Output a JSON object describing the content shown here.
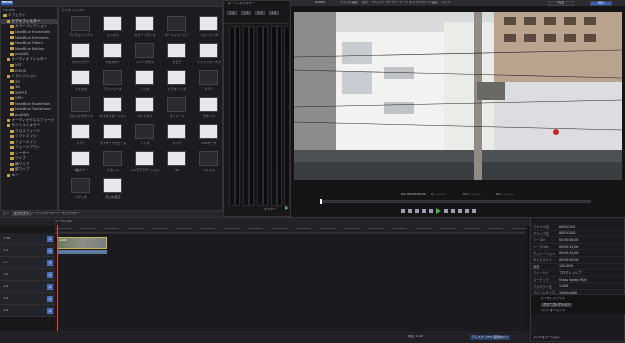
{
  "app": {
    "brand": "EDIUS",
    "brand2": "EDIUS"
  },
  "menus_left": [
    "ファイル",
    "編集",
    "表示",
    "クリップ",
    "マーカー",
    "モード",
    "キャプチャ",
    "ツール",
    "設定",
    "ヘルプ"
  ],
  "menus_right": [
    "ファイル",
    "編集",
    "表示",
    "クリップ",
    "マーカー",
    "モード",
    "キャプチャ",
    "ツール",
    "設定",
    "ヘルプ"
  ],
  "bin": {
    "title": "エフェクト",
    "subtitle": "FOLDER",
    "tree": [
      {
        "label": "エフェクト",
        "level": 0
      },
      {
        "label": "ビデオフィルター",
        "level": 1,
        "selected": true
      },
      {
        "label": "カラーコレクション",
        "level": 2
      },
      {
        "label": "NewBlue Essentials",
        "level": 2
      },
      {
        "label": "NewBlue Elements",
        "level": 2
      },
      {
        "label": "NewBlue Filters",
        "level": 2
      },
      {
        "label": "NewBlue Motion",
        "level": 2
      },
      {
        "label": "proDAD",
        "level": 2
      },
      {
        "label": "オーディオフィルター",
        "level": 1
      },
      {
        "label": "VST",
        "level": 2
      },
      {
        "label": "EDIUS",
        "level": 2
      },
      {
        "label": "トランジション",
        "level": 1
      },
      {
        "label": "2D",
        "level": 2
      },
      {
        "label": "3D",
        "level": 2
      },
      {
        "label": "SMPTE",
        "level": 2
      },
      {
        "label": "GPU",
        "level": 2
      },
      {
        "label": "NewBlue Essentials",
        "level": 2
      },
      {
        "label": "NewBlue Transitions",
        "level": 2
      },
      {
        "label": "proDAD",
        "level": 2
      },
      {
        "label": "オーディオクロスフェード",
        "level": 1
      },
      {
        "label": "タイトルミキサー",
        "level": 1
      },
      {
        "label": "クロスフェード",
        "level": 2
      },
      {
        "label": "ソフトエッジ",
        "level": 2
      },
      {
        "label": "フェードイン",
        "level": 2
      },
      {
        "label": "フェードアウト",
        "level": 2
      },
      {
        "label": "レーザー",
        "level": 2
      },
      {
        "label": "ワイプ",
        "level": 2
      },
      {
        "label": "横ワイプ",
        "level": 2
      },
      {
        "label": "縦ワイプ",
        "level": 2
      },
      {
        "label": "キー",
        "level": 1
      }
    ],
    "breadcrumb": "ビデオフィルター",
    "tabs": [
      "ビン",
      "エフェクト",
      "シーケンスマーカー",
      "ソースブラウザー"
    ]
  },
  "effects": [
    [
      "アンチエイリアス",
      "エンボス",
      "カラーバランス",
      "オールドムービー",
      "スムージング"
    ],
    [
      "ガウスブラー",
      "クロマキー",
      "シャープネス",
      "セピア",
      "ソフトフォーカス"
    ],
    [
      "ストロボ",
      "ディフューズ",
      "ノイズ",
      "ビデオノイズ",
      "ブラー"
    ],
    [
      "ブロックモザイク",
      "ポスタリゼーション",
      "マトリクス",
      "モノトーン",
      "モザイク"
    ],
    [
      "ミラー",
      "ラスタースクロール",
      "レンズ",
      "ワイプ",
      "YUVカーブ"
    ],
    [
      "3軸カラー",
      "ビネット",
      "リニアグラデーション",
      "3D",
      "フィルム"
    ],
    [
      "ステレオ",
      "手ぶれ補正",
      "",
      "",
      " "
    ]
  ],
  "mixer": {
    "title": "オーディオミキサー",
    "channels": [
      "1 A",
      "2 A",
      "3 A",
      "4 A"
    ],
    "values": [
      "0.0",
      "0.0",
      "0.0",
      "0.0"
    ],
    "master_label": "マスター"
  },
  "player": {
    "timecode_in": "Cur 00:00:00;00",
    "timecode_out": "In --:--:--;--",
    "timecode_dur": "Out --:--:--;--",
    "timecode_len": "Dur --:--:--;--",
    "mode": "PLR",
    "rec": "REC"
  },
  "timeline": {
    "title": "シーケンス1",
    "ruler": [
      "00:00:00;00",
      "00:00:05;00",
      "00:00:10;00",
      "00:00:15;00",
      "00:00:20;00",
      "00:00:25;00",
      "00:00:30;00",
      "00:00:35;00",
      "00:00:40;00",
      "00:00:45;00",
      "00:00:50;00",
      "00:00:55;00",
      "00:01:00;00",
      "00:01:05;00",
      "00:01:10;00",
      "00:01:15;00",
      "00:01:20;00",
      "00:01:25;00",
      "00:01:30;00",
      "00:01:35;00"
    ],
    "tracks": [
      {
        "name": "1 VA",
        "tag": "V"
      },
      {
        "name": "2 V",
        "tag": "V"
      },
      {
        "name": "1 T",
        "tag": "T"
      },
      {
        "name": "1 A",
        "tag": "A"
      },
      {
        "name": "2 A",
        "tag": "A"
      },
      {
        "name": "3 A",
        "tag": "A"
      },
      {
        "name": "4 A",
        "tag": "A"
      }
    ],
    "clip_label": "A001",
    "status_left": "ディスク: 27% 使用中(C:)",
    "status_mid": "再生: 0.00",
    "status_right": "ディスク: 27% 使用中(C:)"
  },
  "info": {
    "title": "インフォメーション",
    "rows": [
      [
        "ファイル名",
        "A001C001"
      ],
      [
        "クリップ名",
        "A001C001"
      ],
      [
        "ソースIn",
        "00:00:00;00"
      ],
      [
        "ソースOut",
        "00:00:12;00"
      ],
      [
        "デュレーション",
        "00:00:12;00"
      ],
      [
        "タイムライン",
        "00:00:00;00"
      ],
      [
        "速度",
        "100.00%"
      ],
      [
        "フィールド",
        "プログレッシブ"
      ],
      [
        "コーデック",
        "Grass Valley HQX"
      ],
      [
        "アスペクト比",
        "1.000"
      ],
      [
        "フレームサイズ",
        "1920x1080"
      ],
      [
        "フレームレート",
        "29.97"
      ]
    ],
    "effects_title": "エフェクト",
    "effect_items": [
      "ビデオレイアウト",
      "カラーコレクション",
      "ステレオバランス"
    ],
    "tab": "インフォメーション"
  }
}
